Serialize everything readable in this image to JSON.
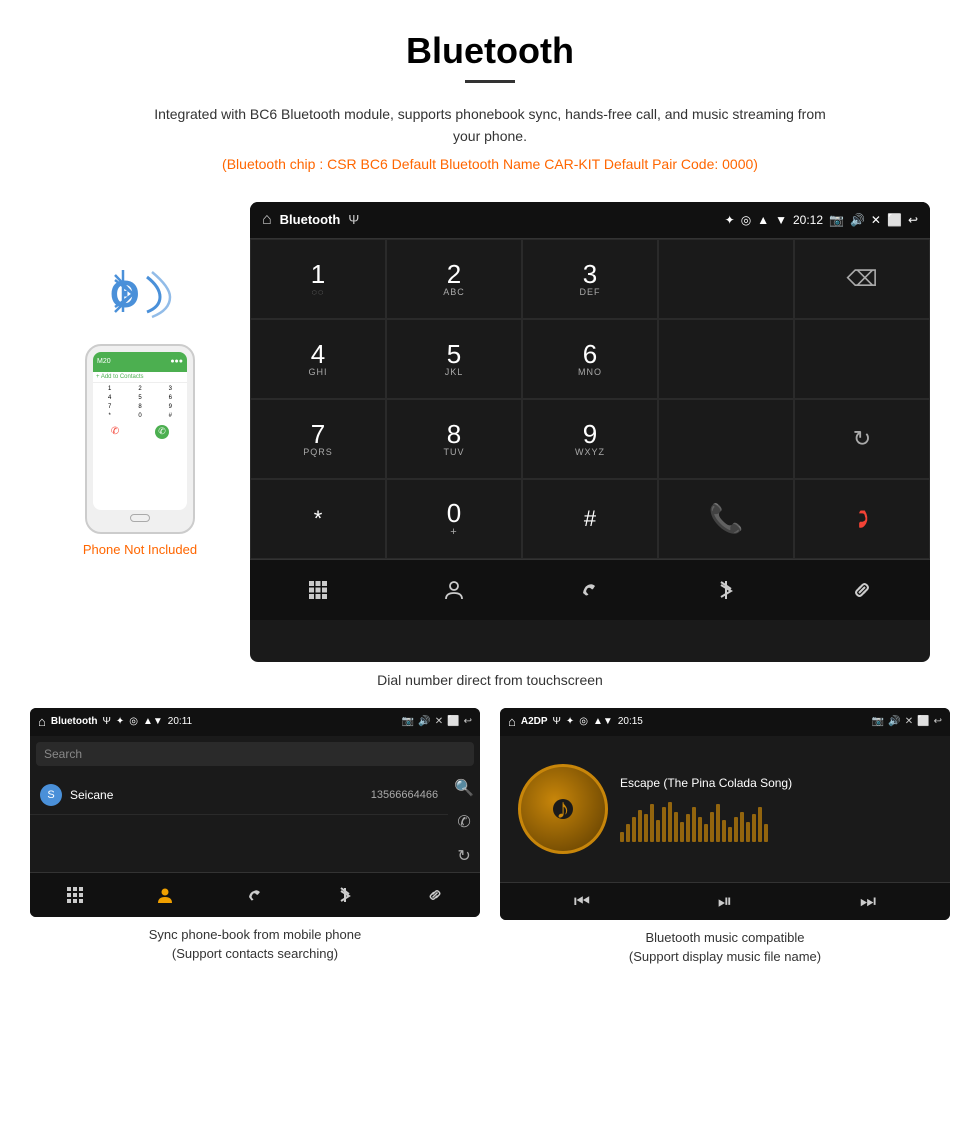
{
  "page": {
    "title": "Bluetooth",
    "description": "Integrated with BC6 Bluetooth module, supports phonebook sync, hands-free call, and music streaming from your phone.",
    "specs": "(Bluetooth chip : CSR BC6    Default Bluetooth Name CAR-KIT    Default Pair Code: 0000)",
    "phone_not_included": "Phone Not Included"
  },
  "dialpad": {
    "title": "Bluetooth",
    "time": "20:12",
    "keys": [
      {
        "num": "1",
        "sub": "◌◌"
      },
      {
        "num": "2",
        "sub": "ABC"
      },
      {
        "num": "3",
        "sub": "DEF"
      },
      {
        "num": "",
        "sub": ""
      },
      {
        "num": "⌫",
        "sub": ""
      },
      {
        "num": "4",
        "sub": "GHI"
      },
      {
        "num": "5",
        "sub": "JKL"
      },
      {
        "num": "6",
        "sub": "MNO"
      },
      {
        "num": "",
        "sub": ""
      },
      {
        "num": "",
        "sub": ""
      },
      {
        "num": "7",
        "sub": "PQRS"
      },
      {
        "num": "8",
        "sub": "TUV"
      },
      {
        "num": "9",
        "sub": "WXYZ"
      },
      {
        "num": "",
        "sub": ""
      },
      {
        "num": "↻",
        "sub": ""
      },
      {
        "num": "*",
        "sub": ""
      },
      {
        "num": "0",
        "sub": "+"
      },
      {
        "num": "#",
        "sub": ""
      },
      {
        "num": "✆",
        "sub": "green"
      },
      {
        "num": "✆",
        "sub": "red"
      }
    ],
    "bottom_icons": [
      "⊞",
      "👤",
      "✆",
      "✦",
      "🔗"
    ],
    "caption": "Dial number direct from touchscreen"
  },
  "phonebook": {
    "status_title": "Bluetooth",
    "time": "20:11",
    "search_placeholder": "Search",
    "contact": {
      "letter": "S",
      "name": "Seicane",
      "number": "13566664466"
    },
    "right_icons": [
      "🔍",
      "✆",
      "↻"
    ],
    "bottom_icons": [
      "⊞",
      "👤",
      "✆",
      "✦",
      "🔗"
    ],
    "caption_line1": "Sync phone-book from mobile phone",
    "caption_line2": "(Support contacts searching)"
  },
  "a2dp": {
    "status_title": "A2DP",
    "time": "20:15",
    "song_title": "Escape (The Pina Colada Song)",
    "visualizer_bars": [
      10,
      18,
      25,
      32,
      28,
      38,
      22,
      35,
      40,
      30,
      20,
      28,
      35,
      25,
      18,
      30,
      38,
      22,
      15,
      25,
      30,
      20,
      28,
      35,
      18
    ],
    "controls": [
      "⏮",
      "⏯",
      "⏭"
    ],
    "caption_line1": "Bluetooth music compatible",
    "caption_line2": "(Support display music file name)"
  }
}
